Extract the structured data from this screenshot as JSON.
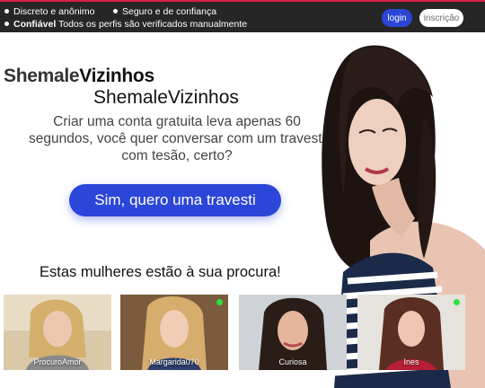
{
  "header": {
    "features": [
      {
        "label": "Discreto e anônimo"
      },
      {
        "label": "Seguro e de confiança"
      },
      {
        "label": "Confiável",
        "detail": "Todos os perfis são verificados manualmente"
      }
    ],
    "login_label": "login",
    "signup_label": "inscrição"
  },
  "hero": {
    "logo_part1": "Shemale",
    "logo_part2": "Vizinhos",
    "site_name": "ShemaleVizinhos",
    "tagline": "Criar uma conta gratuita leva apenas 60 segundos, você quer conversar com um travesti com tesão, certo?",
    "cta_label": "Sim, quero uma travesti"
  },
  "profiles": {
    "title": "Estas mulheres estão à sua procura!",
    "items": [
      {
        "name": "ProcuroAmor",
        "online": false
      },
      {
        "name": "Margarida070",
        "online": true
      },
      {
        "name": "Curiosa",
        "online": false
      },
      {
        "name": "Ines",
        "online": true
      }
    ]
  },
  "colors": {
    "topbar": "#262626",
    "accent_red": "#d81f3d",
    "primary_blue": "#2b46d8",
    "online_green": "#2ee23b"
  }
}
